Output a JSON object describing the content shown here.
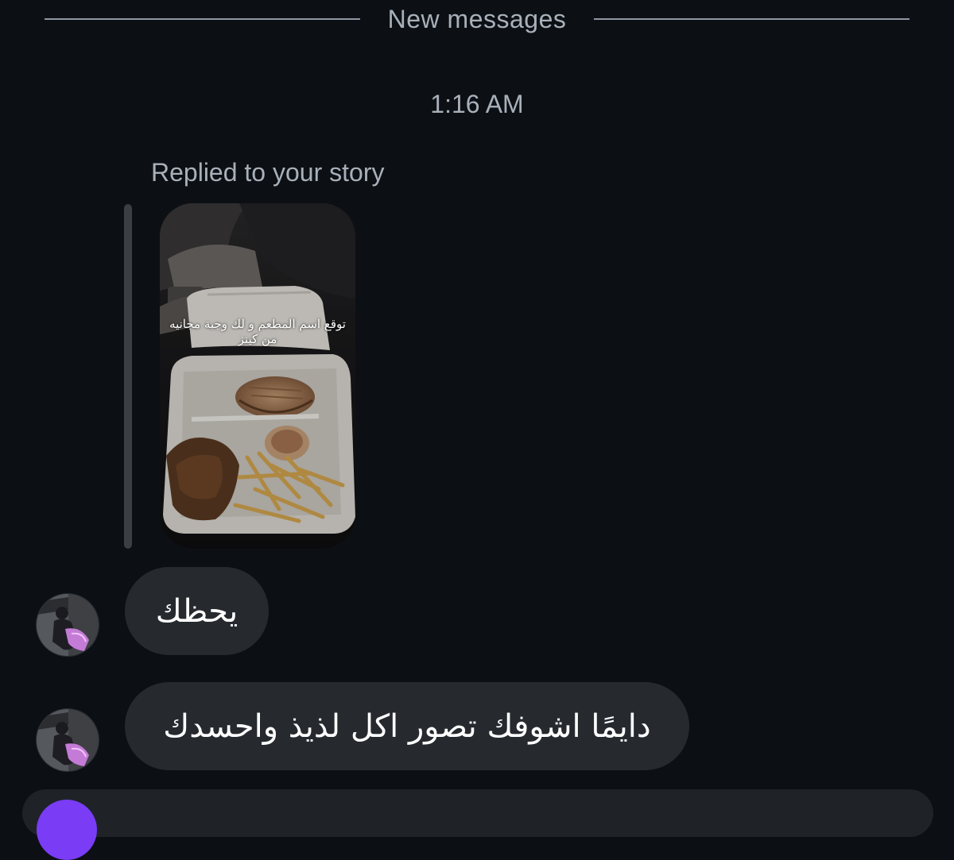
{
  "divider": {
    "label": "New messages"
  },
  "timestamp": "1:16 AM",
  "story_reply": {
    "label": "Replied to your story",
    "caption_line1": "توقع اسم المطعم و لك وجبة مجانيه",
    "caption_line2": "من كينز"
  },
  "messages": [
    {
      "text": "يحظك"
    },
    {
      "text": "دايمًا اشوفك تصور اكل لذيذ واحسدك"
    }
  ],
  "colors": {
    "background": "#0c1014",
    "bubble": "#262a2f",
    "secondary_text": "#a8b0ba",
    "composer_accent": "#7a3cf5"
  }
}
